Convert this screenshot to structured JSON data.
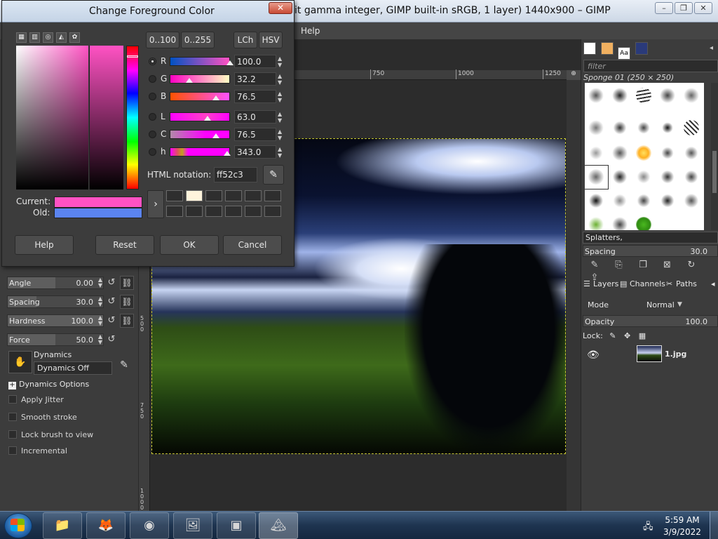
{
  "gimp_window": {
    "title": "it gamma integer, GIMP built-in sRGB, 1 layer) 1440x900 – GIMP",
    "menu_help": "Help",
    "controls": {
      "minimize": "–",
      "restore": "❐",
      "close": "✕"
    }
  },
  "rulers": {
    "top": [
      "750",
      "1000",
      "1250"
    ],
    "left": [
      "5 0 0",
      "7 5 0",
      "1 0 0 0"
    ]
  },
  "tool_options": {
    "sliders": [
      {
        "label": "Angle",
        "value": "0.00",
        "fill": 0.5
      },
      {
        "label": "Spacing",
        "value": "30.0",
        "fill": 0.3
      },
      {
        "label": "Hardness",
        "value": "100.0",
        "fill": 1.0
      },
      {
        "label": "Force",
        "value": "50.0",
        "fill": 0.5
      }
    ],
    "dynamics_label": "Dynamics",
    "dynamics_value": "Dynamics Off",
    "dynamics_options": "Dynamics Options",
    "checks": [
      "Apply Jitter",
      "Smooth stroke",
      "Lock brush to view",
      "Incremental"
    ]
  },
  "brushes": {
    "filter_placeholder": "filter",
    "current": "Sponge 01 (250 × 250)",
    "tag": "Splatters,",
    "spacing_label": "Spacing",
    "spacing_value": "30.0"
  },
  "layers": {
    "tabs": [
      "Layers",
      "Channels",
      "Paths"
    ],
    "mode_label": "Mode",
    "mode_value": "Normal",
    "opacity_label": "Opacity",
    "opacity_value": "100.0",
    "lock_label": "Lock:",
    "layer_name": "1.jpg"
  },
  "dialog": {
    "title": "Change Foreground Color",
    "close": "✕",
    "range_buttons": [
      "0..100",
      "0..255",
      "LCh",
      "HSV"
    ],
    "channels": [
      {
        "label": "R",
        "value": "100.0",
        "selected": true,
        "grad": "linear-gradient(to right,#0052c3,#ff52c3)",
        "pos": 1.0
      },
      {
        "label": "G",
        "value": "32.2",
        "selected": false,
        "grad": "linear-gradient(to right,#ff00c3,#ffffc3)",
        "pos": 0.322
      },
      {
        "label": "B",
        "value": "76.5",
        "selected": false,
        "grad": "linear-gradient(to right,#ff5200,#ff52ff)",
        "pos": 0.765
      },
      {
        "label": "L",
        "value": "63.0",
        "selected": false,
        "grad": "linear-gradient(to right,#ff00ff,#ff40c8 60%,#ff00ff)",
        "pos": 0.63
      },
      {
        "label": "C",
        "value": "76.5",
        "selected": false,
        "grad": "linear-gradient(to right,#b08aa8,#ff00ff 60%)",
        "pos": 0.765
      },
      {
        "label": "h",
        "value": "343.0",
        "selected": false,
        "grad": "linear-gradient(to right,#ff00ff,#e05060 12%,#c0a020 20%,#ff00ff 30%,#ff00ff)",
        "pos": 0.953
      }
    ],
    "html_label": "HTML notation:",
    "html_value": "ff52c3",
    "current_label": "Current:",
    "old_label": "Old:",
    "current_color": "#ff52c3",
    "old_color": "#5b84f0",
    "buttons": {
      "help": "Help",
      "reset": "Reset",
      "ok": "OK",
      "cancel": "Cancel"
    }
  },
  "taskbar": {
    "time": "5:59 AM",
    "date": "3/9/2022"
  }
}
